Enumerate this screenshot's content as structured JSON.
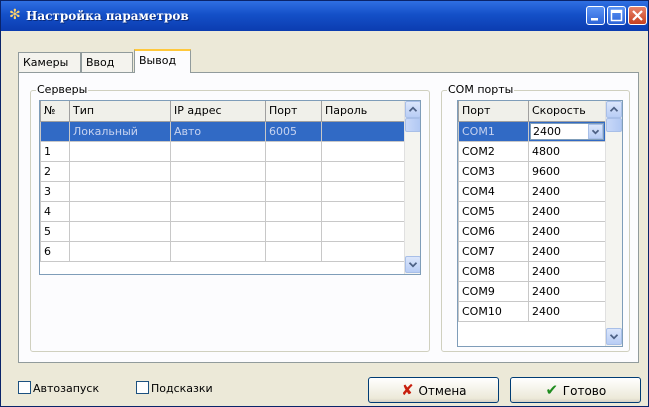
{
  "window": {
    "title": "Настройка параметров"
  },
  "tabs": [
    {
      "label": "Камеры"
    },
    {
      "label": "Ввод"
    },
    {
      "label": "Вывод",
      "active": true
    }
  ],
  "servers": {
    "label": "Серверы",
    "columns": [
      "№",
      "Тип",
      "IP адрес",
      "Порт",
      "Пароль"
    ],
    "rows": [
      {
        "num": "",
        "type": "Локальный",
        "ip": "Авто",
        "port": "6005",
        "password": "",
        "selected": true
      },
      {
        "num": "1",
        "type": "",
        "ip": "",
        "port": "",
        "password": ""
      },
      {
        "num": "2",
        "type": "",
        "ip": "",
        "port": "",
        "password": ""
      },
      {
        "num": "3",
        "type": "",
        "ip": "",
        "port": "",
        "password": ""
      },
      {
        "num": "4",
        "type": "",
        "ip": "",
        "port": "",
        "password": ""
      },
      {
        "num": "5",
        "type": "",
        "ip": "",
        "port": "",
        "password": ""
      },
      {
        "num": "6",
        "type": "",
        "ip": "",
        "port": "",
        "password": ""
      }
    ]
  },
  "com_ports": {
    "label": "COM порты",
    "columns": [
      "Порт",
      "Скорость"
    ],
    "rows": [
      {
        "port": "COM1",
        "speed": "2400",
        "selected": true
      },
      {
        "port": "COM2",
        "speed": "4800"
      },
      {
        "port": "COM3",
        "speed": "9600"
      },
      {
        "port": "COM4",
        "speed": "2400"
      },
      {
        "port": "COM5",
        "speed": "2400"
      },
      {
        "port": "COM6",
        "speed": "2400"
      },
      {
        "port": "COM7",
        "speed": "2400"
      },
      {
        "port": "COM8",
        "speed": "2400"
      },
      {
        "port": "COM9",
        "speed": "2400"
      },
      {
        "port": "COM10",
        "speed": "2400"
      }
    ]
  },
  "footer": {
    "autostart_label": "Автозапуск",
    "hints_label": "Подсказки",
    "cancel_label": "Отмена",
    "ok_label": "Готово"
  },
  "colors": {
    "selection": "#316ac5",
    "title_bar": "#1450c8"
  }
}
